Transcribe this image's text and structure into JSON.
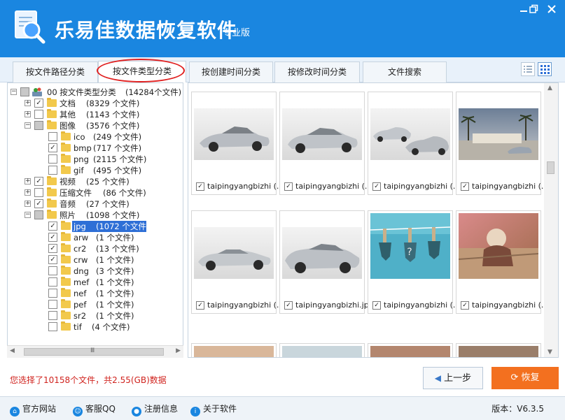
{
  "app": {
    "title": "乐易佳数据恢复软件",
    "edition": "专业版",
    "minimize_icon": "minimize-icon",
    "restore_icon": "restore-icon",
    "close_icon": "close-icon"
  },
  "tabs": [
    {
      "label": "按文件路径分类",
      "active": false
    },
    {
      "label": "按文件类型分类",
      "active": true
    },
    {
      "label": "按创建时间分类",
      "active": false
    },
    {
      "label": "按修改时间分类",
      "active": false
    },
    {
      "label": "文件搜索",
      "active": false
    }
  ],
  "tree": {
    "root": {
      "label": "00 按文件类型分类",
      "count": "(14284个文件)"
    },
    "items": [
      {
        "label": "文档",
        "count": "(8329 个文件)",
        "checked": true
      },
      {
        "label": "其他",
        "count": "(1143 个文件)",
        "checked": false
      },
      {
        "label": "图像",
        "count": "(3576 个文件)",
        "checked": "partial"
      },
      {
        "label": "ico",
        "count": "(249 个文件)",
        "checked": false
      },
      {
        "label": "bmp",
        "count": "(717 个文件)",
        "checked": true
      },
      {
        "label": "png",
        "count": "(2115 个文件)",
        "checked": false
      },
      {
        "label": "gif",
        "count": "(495 个文件)",
        "checked": false
      },
      {
        "label": "视频",
        "count": "(25 个文件)",
        "checked": true
      },
      {
        "label": "压缩文件",
        "count": "(86 个文件)",
        "checked": false
      },
      {
        "label": "音频",
        "count": "(27 个文件)",
        "checked": true
      },
      {
        "label": "照片",
        "count": "(1098 个文件)",
        "checked": "partial"
      },
      {
        "label": "jpg",
        "count": "(1072 个文件)",
        "checked": true,
        "selected": true
      },
      {
        "label": "arw",
        "count": "(1 个文件)",
        "checked": true
      },
      {
        "label": "cr2",
        "count": "(13 个文件)",
        "checked": true
      },
      {
        "label": "crw",
        "count": "(1 个文件)",
        "checked": true
      },
      {
        "label": "dng",
        "count": "(3 个文件)",
        "checked": false
      },
      {
        "label": "mef",
        "count": "(1 个文件)",
        "checked": false
      },
      {
        "label": "nef",
        "count": "(1 个文件)",
        "checked": false
      },
      {
        "label": "pef",
        "count": "(1 个文件)",
        "checked": false
      },
      {
        "label": "sr2",
        "count": "(1 个文件)",
        "checked": false
      },
      {
        "label": "tif",
        "count": "(4 个文件)",
        "checked": false
      }
    ],
    "scroll_glyph": "Ⅲ"
  },
  "grid": {
    "files": [
      {
        "name": "taipingyangbizhi (...",
        "checked": true
      },
      {
        "name": "taipingyangbizhi (...",
        "checked": true
      },
      {
        "name": "taipingyangbizhi (...",
        "checked": true
      },
      {
        "name": "taipingyangbizhi (...",
        "checked": true
      },
      {
        "name": "taipingyangbizhi (...",
        "checked": true
      },
      {
        "name": "taipingyangbizhi.jpg",
        "checked": true
      },
      {
        "name": "taipingyangbizhi (...",
        "checked": true
      },
      {
        "name": "taipingyangbizhi (...",
        "checked": true
      }
    ]
  },
  "status": {
    "text": "您选择了10158个文件，共2.55(GB)数据"
  },
  "buttons": {
    "prev": "上一步",
    "recover": "恢复"
  },
  "footer": {
    "links": [
      "官方网站",
      "客服QQ",
      "注册信息",
      "关于软件"
    ],
    "version": "版本：V6.3.5"
  },
  "colors": {
    "brand": "#1a86e0",
    "recover": "#f3701f",
    "status": "#d0231e"
  }
}
